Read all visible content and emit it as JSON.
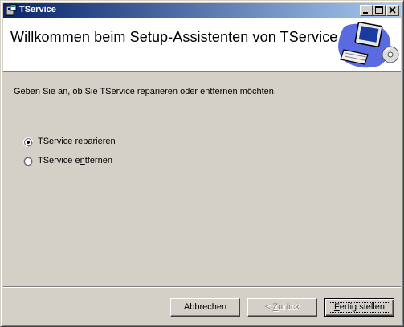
{
  "window": {
    "title": "TService"
  },
  "header": {
    "title": "Willkommen beim Setup-Assistenten von TService"
  },
  "body": {
    "instruction": "Geben Sie an, ob Sie TService reparieren oder entfernen möchten.",
    "options": [
      {
        "label_pre": "TService ",
        "label_accel": "r",
        "label_post": "eparieren",
        "selected": true
      },
      {
        "label_pre": "TService e",
        "label_accel": "n",
        "label_post": "tfernen",
        "selected": false
      }
    ]
  },
  "buttons": {
    "cancel": {
      "label": "Abbrechen"
    },
    "back": {
      "label_pre": "< ",
      "label_accel": "Z",
      "label_post": "urück",
      "enabled": false
    },
    "finish": {
      "label_accel": "F",
      "label_post": "ertig stellen"
    }
  }
}
